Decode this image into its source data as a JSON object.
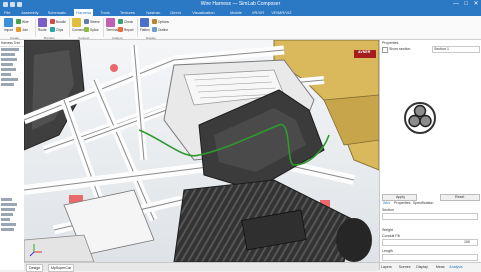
{
  "window": {
    "title": "Wire Harness — SimLab Composer",
    "minimize": "—",
    "maximize": "□",
    "close": "✕"
  },
  "menu": {
    "tabs": [
      "File",
      "Assembly",
      "Schematic",
      "Harness",
      "Tools",
      "Textures",
      "Nastran",
      "Direct",
      "Visualization",
      "Mobile",
      "VR/XR",
      "VR/MR/VIZ"
    ],
    "active_index": 3
  },
  "ribbon": {
    "buttons": [
      {
        "label": "Import",
        "icon": "import-icon"
      },
      {
        "label": "Wire",
        "icon": "wire-icon"
      },
      {
        "label": "Join",
        "icon": "join-icon"
      },
      {
        "label": "Route",
        "icon": "route-icon"
      },
      {
        "label": "Bundle",
        "icon": "bundle-icon"
      },
      {
        "label": "Clips",
        "icon": "clip-icon"
      },
      {
        "label": "Connectors",
        "icon": "connector-icon"
      },
      {
        "label": "Sleeve",
        "icon": "sleeve-icon"
      },
      {
        "label": "Splice",
        "icon": "splice-icon"
      },
      {
        "label": "Terminals",
        "icon": "terminal-icon"
      },
      {
        "label": "Check",
        "icon": "check-icon"
      },
      {
        "label": "Report",
        "icon": "report-icon"
      },
      {
        "label": "Flatten",
        "icon": "flatten-icon"
      },
      {
        "label": "Options",
        "icon": "options-icon"
      },
      {
        "label": "Outline",
        "icon": "outline-icon"
      }
    ],
    "groups": [
      "Create",
      "Bundles",
      "Connect",
      "Analyze",
      "Display"
    ]
  },
  "left_panel": {
    "title": "Harness Tree"
  },
  "viewport": {
    "label_badge": "AVNER"
  },
  "bottom_tabs": [
    "Design",
    "MySuperCar"
  ],
  "right_panel": {
    "title": "Properties",
    "filter_label": "Show section",
    "filter_value": "Section 1",
    "cross_section_label": "Cross Section",
    "buttons": [
      "Apply",
      "Reset"
    ],
    "subtabs": [
      "Wire",
      "Properties",
      "Specification"
    ],
    "field_label": "Section",
    "weight_label": "Weight",
    "conduit_label": "Conduit Fill",
    "conduit_value": "100",
    "length_label": "Length",
    "bottom_tabs": [
      "Layers",
      "Scenes",
      "Display",
      "Meas",
      "Analysis"
    ]
  },
  "colors": {
    "titlebar": "#2b78c4",
    "wire": "#2e9a2e",
    "chassis": "#ffffff",
    "tire": "#3a3a3a",
    "body": "#d8b85a",
    "accent_red": "#e86a6a"
  }
}
